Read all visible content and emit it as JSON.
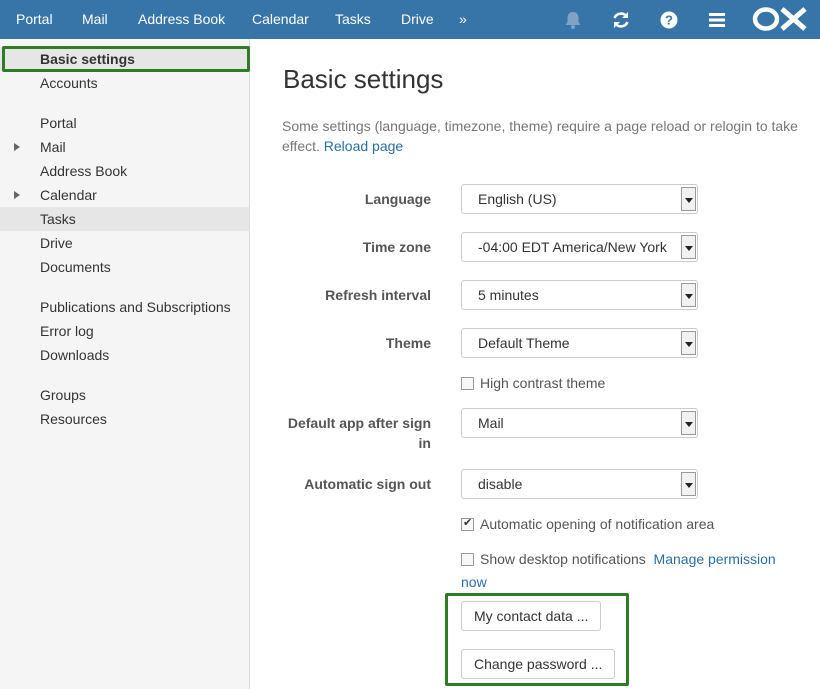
{
  "topbar": {
    "nav": [
      "Portal",
      "Mail",
      "Address Book",
      "Calendar",
      "Tasks",
      "Drive",
      "»"
    ],
    "icons": [
      "bell-icon",
      "refresh-icon",
      "help-icon",
      "menu-icon"
    ],
    "logo": "OX",
    "bg_color": "#3774a8"
  },
  "sidebar": {
    "items": [
      "Basic settings",
      "Accounts",
      "Portal",
      "Mail",
      "Address Book",
      "Calendar",
      "Tasks",
      "Drive",
      "Documents",
      "Publications and Subscriptions",
      "Error log",
      "Downloads",
      "Groups",
      "Resources"
    ],
    "expandable": [
      "Mail",
      "Calendar"
    ],
    "selected": "Basic settings",
    "hover": "Tasks"
  },
  "main": {
    "title": "Basic settings",
    "info_text": "Some settings (language, timezone, theme) require a page reload or relogin to take effect.",
    "reload_link": "Reload page",
    "fields": {
      "language": {
        "label": "Language",
        "value": "English (US)"
      },
      "timezone": {
        "label": "Time zone",
        "value": "-04:00 EDT America/New York"
      },
      "refresh": {
        "label": "Refresh interval",
        "value": "5 minutes"
      },
      "theme": {
        "label": "Theme",
        "value": "Default Theme"
      },
      "default_app": {
        "label": "Default app after sign in",
        "value": "Mail"
      },
      "auto_signout": {
        "label": "Automatic sign out",
        "value": "disable"
      }
    },
    "checkboxes": {
      "high_contrast": {
        "label": "High contrast theme",
        "checked": false
      },
      "auto_notification": {
        "label": "Automatic opening of notification area",
        "checked": true
      },
      "desktop_notifications": {
        "label": "Show desktop notifications",
        "checked": false,
        "link": "Manage permission now"
      }
    },
    "buttons": {
      "contact": "My contact data ...",
      "password": "Change password ..."
    }
  },
  "highlight_color": "#2e7d24"
}
